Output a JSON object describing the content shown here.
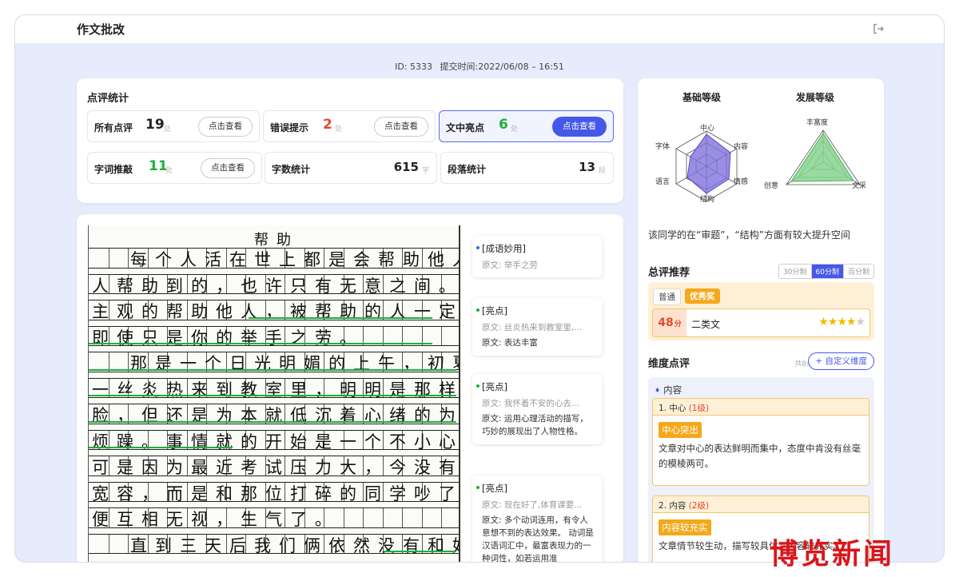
{
  "header": {
    "title": "作文批改"
  },
  "meta": {
    "id_text": "ID: 5333",
    "submit_text": "提交时间:2022/06/08 – 16:51"
  },
  "stats": {
    "title": "点评统计",
    "items": [
      {
        "label": "所有点评",
        "value": "19",
        "unit": "处",
        "button": "点击查看"
      },
      {
        "label": "错误提示",
        "value": "2",
        "unit": "处",
        "button": "点击查看"
      },
      {
        "label": "文中亮点",
        "value": "6",
        "unit": "处",
        "button": "点击查看"
      },
      {
        "label": "字词推敲",
        "value": "11",
        "unit": "处",
        "button": "点击查看"
      },
      {
        "label": "字数统计",
        "value": "615",
        "unit": "字"
      },
      {
        "label": "段落统计",
        "value": "13",
        "unit": "段"
      }
    ]
  },
  "essay": {
    "title": "帮助",
    "lines": [
      "每个人活在世上都是会帮助他人，或被他",
      "人帮助到的，也许只有无意之间。不管是否是",
      "主观的帮助他人，被帮助的人一定会心怀感激",
      "即使只是你的举手之劳。",
      "那是一个日光明媚的上午，初夏的风带着",
      "一丝炎热来到教室里，明明是那样轻柔的拂过",
      "脸，但还是为本就低沉着心绪的为增添了一丝",
      "烦躁。事情就的开始是一个不小心打碎的水杯，",
      "可是因为最近考试压力大，今没有像平常那样",
      "宽容，而是和那位打碎的同学吵了一架。随后",
      "便互相无视，生气了。",
      "直到三天后我们俩依然没有和好。我怀着不"
    ]
  },
  "comments": [
    {
      "title": "[成语妙用]",
      "orig": "原文: 举手之劳",
      "body": ""
    },
    {
      "title": "[亮点]",
      "orig": "原文: 丝炎热来到教室里,...",
      "body": "原文: 表达丰富"
    },
    {
      "title": "[亮点]",
      "orig": "原文: 我怀着不安的心去...",
      "body": "原文: 运用心理活动的描写，巧妙的展现出了人物性格。"
    },
    {
      "title": "[亮点]",
      "orig": "原文: 现在好了,体育课要...",
      "body": "原文: 多个动词连用，有令人意想不到的表达效果。 动词是汉语词汇中，最富表现力的一种词性，如若运用准"
    }
  ],
  "levels": {
    "basic": {
      "title": "基础等级",
      "labels": [
        "中心",
        "内容",
        "情感",
        "结构",
        "语言",
        "字体"
      ]
    },
    "development": {
      "title": "发展等级",
      "labels": [
        "丰富度",
        "文采",
        "创意"
      ]
    }
  },
  "summary": "该同学的在“审题”，“结构”方面有较大提升空间",
  "recommend": {
    "title": "总评推荐",
    "segments": [
      "30分制",
      "60分制",
      "百分制"
    ],
    "tags": [
      "普通",
      "优秀奖"
    ],
    "score": "48",
    "score_unit": "分",
    "class_name": "二类文",
    "stars": 4
  },
  "dimension": {
    "title": "维度点评",
    "count": "共8点",
    "add_button": "+ 自定义维度",
    "group": "内容",
    "items": [
      {
        "head": "1. 中心",
        "level": "(1级)",
        "pill": "中心突出",
        "text": "文章对中心的表达鲜明而集中，态度中肯没有丝毫的模棱两可。"
      },
      {
        "head": "2. 内容",
        "level": "(2级)",
        "pill": "内容较充实",
        "text": "文章情节较生动，描写较具体，内容较充实。"
      }
    ]
  },
  "watermark": "博览新闻",
  "colors": {
    "accent": "#4558e8",
    "error": "#e54a2f",
    "success": "#1bb03a",
    "award": "#f4a81b",
    "radar_basic": "#8a7fe0",
    "radar_dev": "#7fd08a"
  }
}
